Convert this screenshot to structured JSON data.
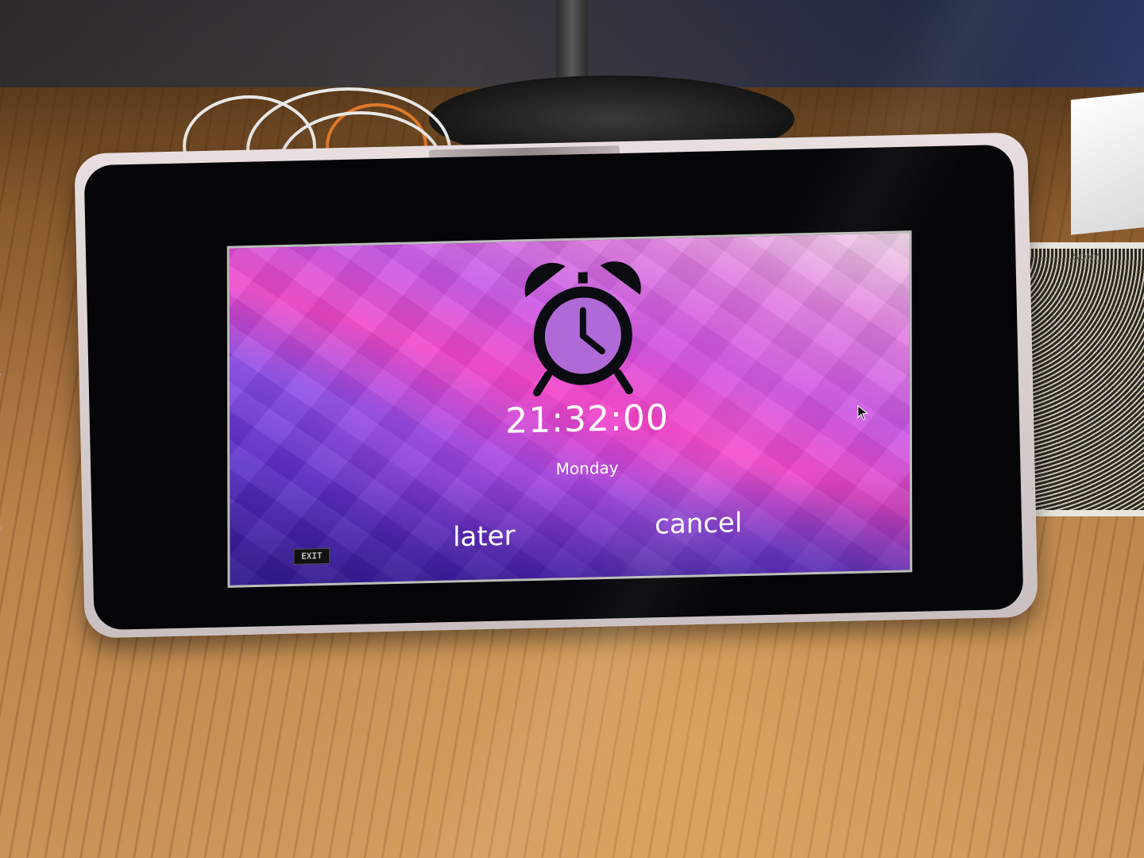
{
  "alarm": {
    "icon": "alarm-clock-icon",
    "time": "21:32:00",
    "day": "Monday"
  },
  "actions": {
    "later_label": "later",
    "cancel_label": "cancel",
    "exit_label": "EXIT"
  },
  "pointer": "mouse-pointer-icon",
  "background": {
    "style": "low-poly gradient",
    "colors": [
      "#f1d6e8",
      "#e07be0",
      "#f048c9",
      "#8c4ce9",
      "#361a9a"
    ]
  },
  "hardware": {
    "speaker_brand": "SONY"
  }
}
